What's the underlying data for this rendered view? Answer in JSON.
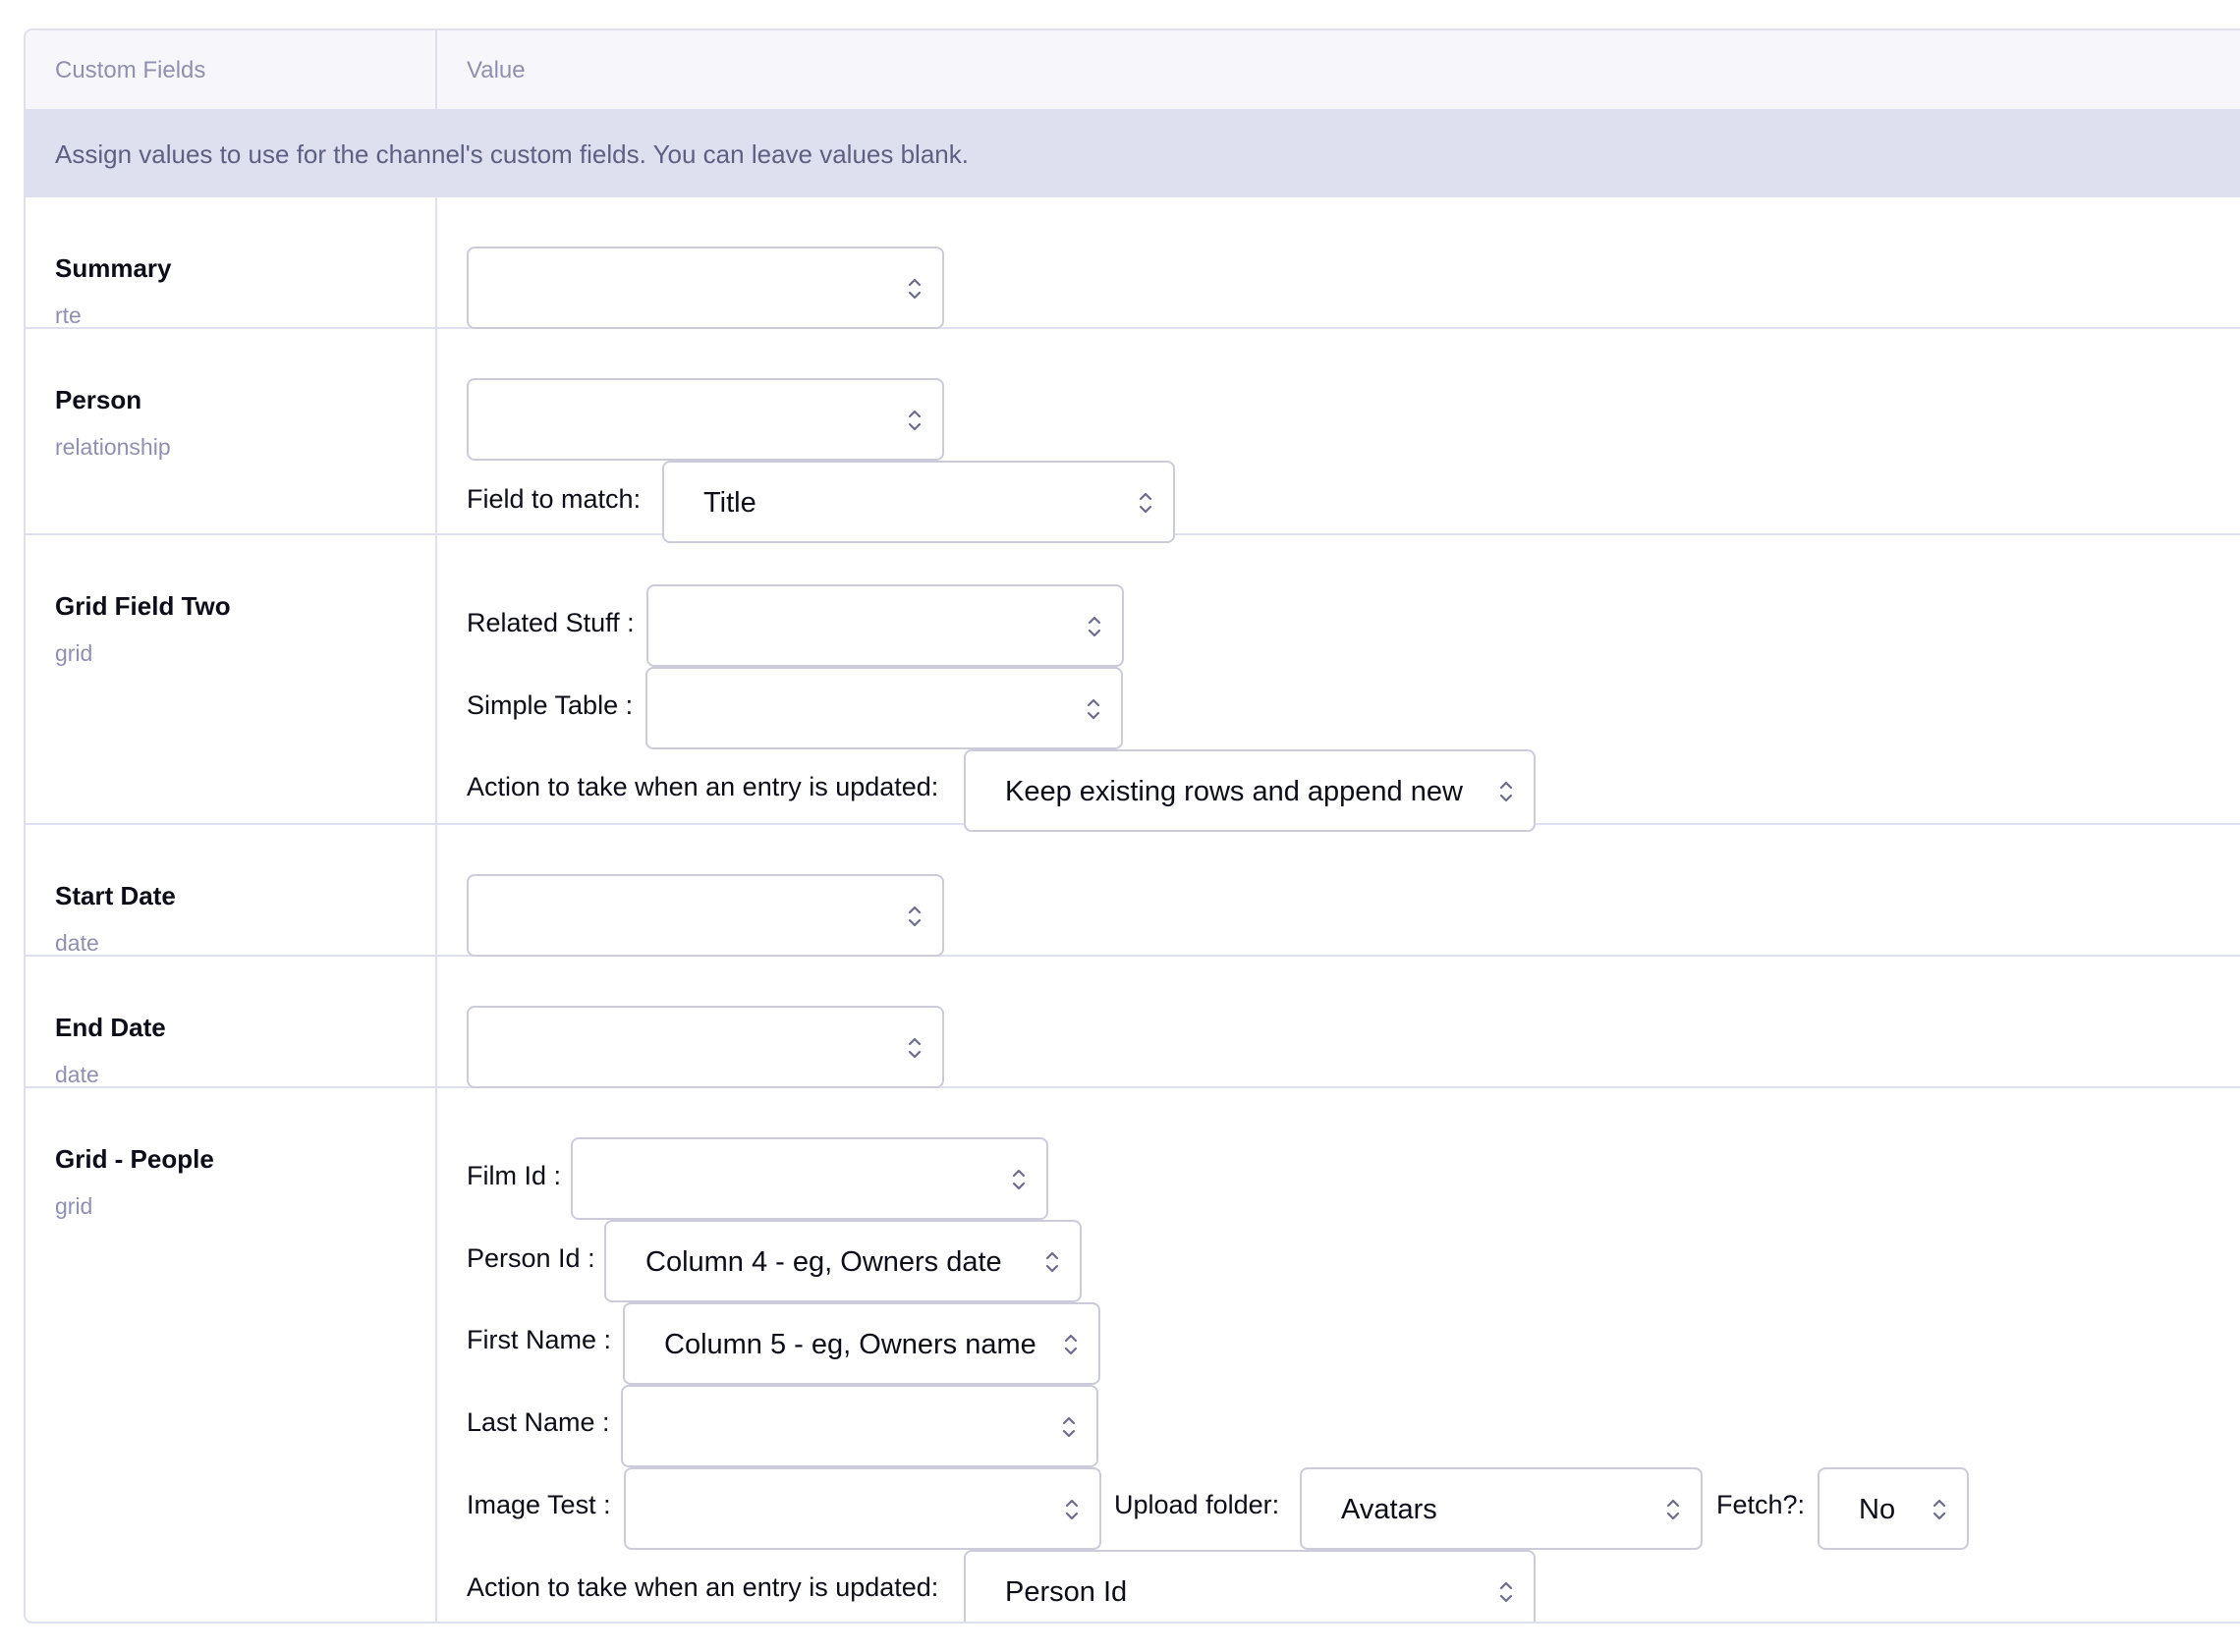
{
  "header": {
    "col1": "Custom Fields",
    "col2": "Value"
  },
  "notice": "Assign values to use for the channel's custom fields. You can leave values blank.",
  "fields": {
    "summary": {
      "label": "Summary",
      "type": "rte",
      "select_value": ""
    },
    "person": {
      "label": "Person",
      "type": "relationship",
      "select_value": "",
      "match_label": "Field to match:",
      "match_value": "Title"
    },
    "grid_two": {
      "label": "Grid Field Two",
      "type": "grid",
      "related_label": "Related Stuff :",
      "related_value": "",
      "simple_label": "Simple Table :",
      "simple_value": "",
      "action_label": "Action to take when an entry is updated:",
      "action_value": "Keep existing rows and append new"
    },
    "start_date": {
      "label": "Start Date",
      "type": "date",
      "select_value": ""
    },
    "end_date": {
      "label": "End Date",
      "type": "date",
      "select_value": ""
    },
    "grid_people": {
      "label": "Grid - People",
      "type": "grid",
      "film_label": "Film Id :",
      "film_value": "",
      "person_label": "Person Id :",
      "person_value": "Column 4 - eg, Owners date",
      "first_label": "First Name :",
      "first_value": "Column 5 - eg, Owners name",
      "last_label": "Last Name :",
      "last_value": "",
      "image_label": "Image Test :",
      "image_value": "",
      "upload_label": "Upload folder:",
      "upload_value": "Avatars",
      "fetch_label": "Fetch?:",
      "fetch_value": "No",
      "action_label": "Action to take when an entry is updated:",
      "action_value": "Person Id"
    }
  },
  "icons": {
    "select_caret": "chevron-up-down-icon"
  },
  "colors": {
    "border": "#dfe0ef",
    "notice_bg": "#dfe0ef",
    "muted_text": "#8f90b0"
  }
}
